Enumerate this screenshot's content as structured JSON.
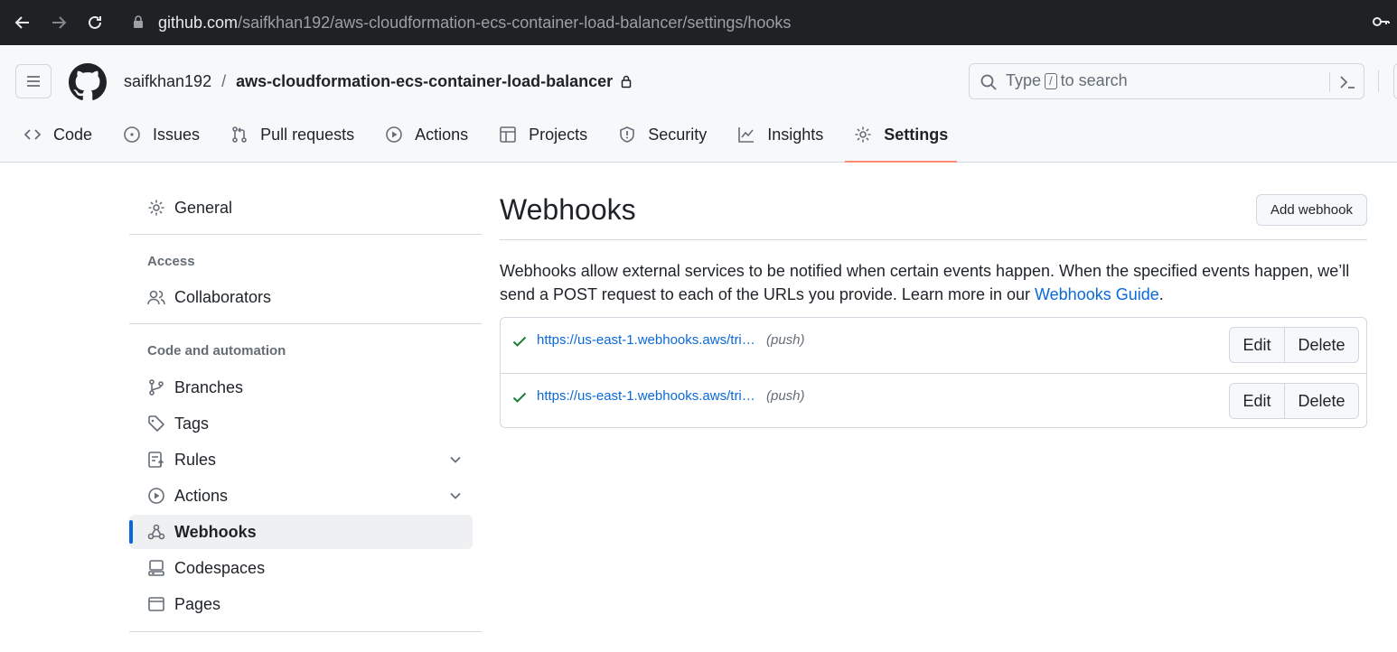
{
  "browser": {
    "url_host": "github.com",
    "url_path": "/saifkhan192/aws-cloudformation-ecs-container-load-balancer/settings/hooks"
  },
  "header": {
    "owner": "saifkhan192",
    "separator": "/",
    "repo": "aws-cloudformation-ecs-container-load-balancer",
    "search": {
      "prefix": "Type",
      "key": "/",
      "suffix": "to search"
    }
  },
  "tabs": [
    {
      "label": "Code",
      "icon": "code-icon"
    },
    {
      "label": "Issues",
      "icon": "issue-icon"
    },
    {
      "label": "Pull requests",
      "icon": "pull-request-icon"
    },
    {
      "label": "Actions",
      "icon": "play-icon"
    },
    {
      "label": "Projects",
      "icon": "table-icon"
    },
    {
      "label": "Security",
      "icon": "shield-icon"
    },
    {
      "label": "Insights",
      "icon": "graph-icon"
    },
    {
      "label": "Settings",
      "icon": "gear-icon",
      "selected": true
    }
  ],
  "sidebar": {
    "general": "General",
    "access_heading": "Access",
    "collaborators": "Collaborators",
    "code_heading": "Code and automation",
    "branches": "Branches",
    "tags": "Tags",
    "rules": "Rules",
    "actions": "Actions",
    "webhooks": "Webhooks",
    "codespaces": "Codespaces",
    "pages": "Pages"
  },
  "main": {
    "title": "Webhooks",
    "add_button": "Add webhook",
    "description": "Webhooks allow external services to be notified when certain events happen. When the specified events happen, we’ll send a POST request to each of the URLs you provide. Learn more in our ",
    "guide_link": "Webhooks Guide",
    "description_end": ".",
    "hooks": [
      {
        "url": "https://us-east-1.webhooks.aws/tri…",
        "event": "(push)",
        "edit": "Edit",
        "delete": "Delete"
      },
      {
        "url": "https://us-east-1.webhooks.aws/tri…",
        "event": "(push)",
        "edit": "Edit",
        "delete": "Delete"
      }
    ]
  },
  "colors": {
    "accent": "#0969da",
    "tab_underline": "#fd8c73",
    "success": "#1a7f37"
  }
}
